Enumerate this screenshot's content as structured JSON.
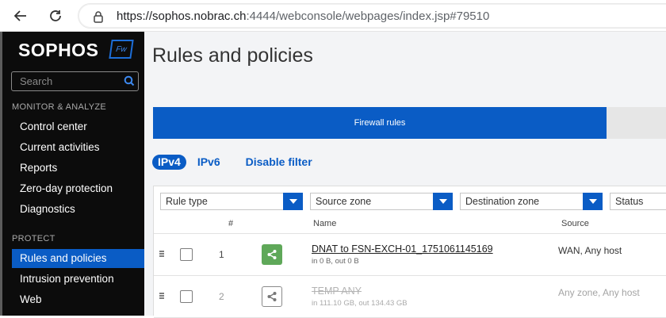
{
  "browser": {
    "url_host": "https://sophos.nobrac.ch",
    "url_path": ":4444/webconsole/webpages/index.jsp#79510"
  },
  "sidebar": {
    "brand": "SOPHOS",
    "badge": "Fw",
    "search_placeholder": "Search",
    "sections": [
      {
        "title": "MONITOR & ANALYZE",
        "items": [
          {
            "label": "Control center"
          },
          {
            "label": "Current activities"
          },
          {
            "label": "Reports"
          },
          {
            "label": "Zero-day protection"
          },
          {
            "label": "Diagnostics"
          }
        ]
      },
      {
        "title": "PROTECT",
        "items": [
          {
            "label": "Rules and policies",
            "active": true
          },
          {
            "label": "Intrusion prevention"
          },
          {
            "label": "Web"
          }
        ]
      }
    ]
  },
  "main": {
    "title": "Rules and policies",
    "tabs": [
      {
        "label": "Firewall rules",
        "active": true
      }
    ],
    "filters": {
      "ipv4": "IPv4",
      "ipv6": "IPv6",
      "disable_filter": "Disable filter"
    },
    "dropdowns": [
      "Rule type",
      "Source zone",
      "Destination zone",
      "Status"
    ],
    "columns": {
      "num": "#",
      "name": "Name",
      "source": "Source"
    },
    "rows": [
      {
        "num": "1",
        "name": "DNAT to FSN-EXCH-01_1751061145169",
        "sub": "in 0 B, out 0 B",
        "source": "WAN, Any host",
        "enabled": true
      },
      {
        "num": "2",
        "name": "TEMP ANY",
        "sub": "in 111.10 GB, out 134.43 GB",
        "source": "Any zone, Any host",
        "enabled": false
      }
    ]
  },
  "colors": {
    "accent": "#0a5cc5",
    "rule_enabled": "#5fa859"
  }
}
